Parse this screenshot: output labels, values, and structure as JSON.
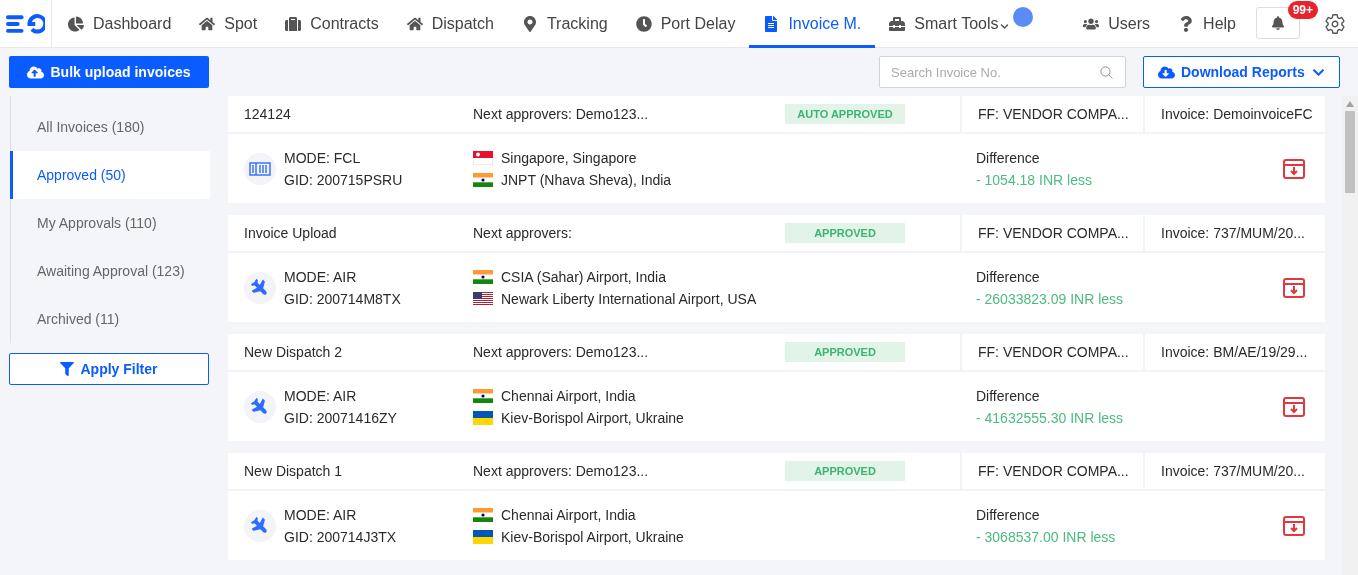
{
  "nav": {
    "items": [
      {
        "label": "Dashboard",
        "selected": false,
        "dropdown": false
      },
      {
        "label": "Spot",
        "selected": false,
        "dropdown": false
      },
      {
        "label": "Contracts",
        "selected": false,
        "dropdown": false
      },
      {
        "label": "Dispatch",
        "selected": false,
        "dropdown": false
      },
      {
        "label": "Tracking",
        "selected": false,
        "dropdown": false
      },
      {
        "label": "Port Delay",
        "selected": false,
        "dropdown": false
      },
      {
        "label": "Invoice M.",
        "selected": true,
        "dropdown": false
      },
      {
        "label": "Smart Tools",
        "selected": false,
        "dropdown": true
      }
    ],
    "right": [
      {
        "label": "Users"
      },
      {
        "label": "Help"
      }
    ],
    "notifications": "99+"
  },
  "toolbar": {
    "upload_button": "Bulk upload invoices",
    "search": {
      "placeholder": "Search Invoice No."
    },
    "download_button": "Download Reports"
  },
  "sidebar": {
    "items": [
      {
        "label": "All Invoices (180)",
        "selected": false
      },
      {
        "label": "Approved (50)",
        "selected": true
      },
      {
        "label": "My Approvals (110)",
        "selected": false
      },
      {
        "label": "Awaiting Approval (123)",
        "selected": false
      },
      {
        "label": "Archived (11)",
        "selected": false
      }
    ],
    "filter_button": "Apply Filter"
  },
  "invoices": [
    {
      "title": "124124",
      "approvers": "Next approvers: Demo123...",
      "status": "AUTO APPROVED",
      "ff": "FF: VENDOR COMPA...",
      "invoice": "Invoice: DemoinvoiceFC",
      "kind": "container",
      "mode": "MODE: FCL",
      "gid": "GID: 200715PSRU",
      "route": [
        {
          "kind": "sg",
          "place": "Singapore, Singapore"
        },
        {
          "kind": "in",
          "place": "JNPT (Nhava Sheva), India"
        }
      ],
      "difference_label": "Difference",
      "difference": "- 1054.18 INR less"
    },
    {
      "title": "Invoice Upload",
      "approvers": "Next approvers:",
      "status": "APPROVED",
      "ff": "FF: VENDOR COMPA...",
      "invoice": "Invoice: 737/MUM/20...",
      "kind": "plane",
      "mode": "MODE: AIR",
      "gid": "GID: 200714M8TX",
      "route": [
        {
          "kind": "in",
          "place": "CSIA (Sahar) Airport, India"
        },
        {
          "kind": "us",
          "place": "Newark Liberty International Airport, USA"
        }
      ],
      "difference_label": "Difference",
      "difference": "- 26033823.09 INR less"
    },
    {
      "title": "New Dispatch 2",
      "approvers": "Next approvers: Demo123...",
      "status": "APPROVED",
      "ff": "FF: VENDOR COMPA...",
      "invoice": "Invoice: BM/AE/19/29...",
      "kind": "plane",
      "mode": "MODE: AIR",
      "gid": "GID: 20071416ZY",
      "route": [
        {
          "kind": "in",
          "place": "Chennai Airport, India"
        },
        {
          "kind": "ua",
          "place": "Kiev-Borispol Airport, Ukraine"
        }
      ],
      "difference_label": "Difference",
      "difference": "- 41632555.30 INR less"
    },
    {
      "title": "New Dispatch 1",
      "approvers": "Next approvers: Demo123...",
      "status": "APPROVED",
      "ff": "FF: VENDOR COMPA...",
      "invoice": "Invoice: 737/MUM/20...",
      "kind": "plane",
      "mode": "MODE: AIR",
      "gid": "GID: 200714J3TX",
      "route": [
        {
          "kind": "in",
          "place": "Chennai Airport, India"
        },
        {
          "kind": "ua",
          "place": "Kiev-Borispol Airport, Ukraine"
        }
      ],
      "difference_label": "Difference",
      "difference": "- 3068537.00 INR less"
    }
  ]
}
